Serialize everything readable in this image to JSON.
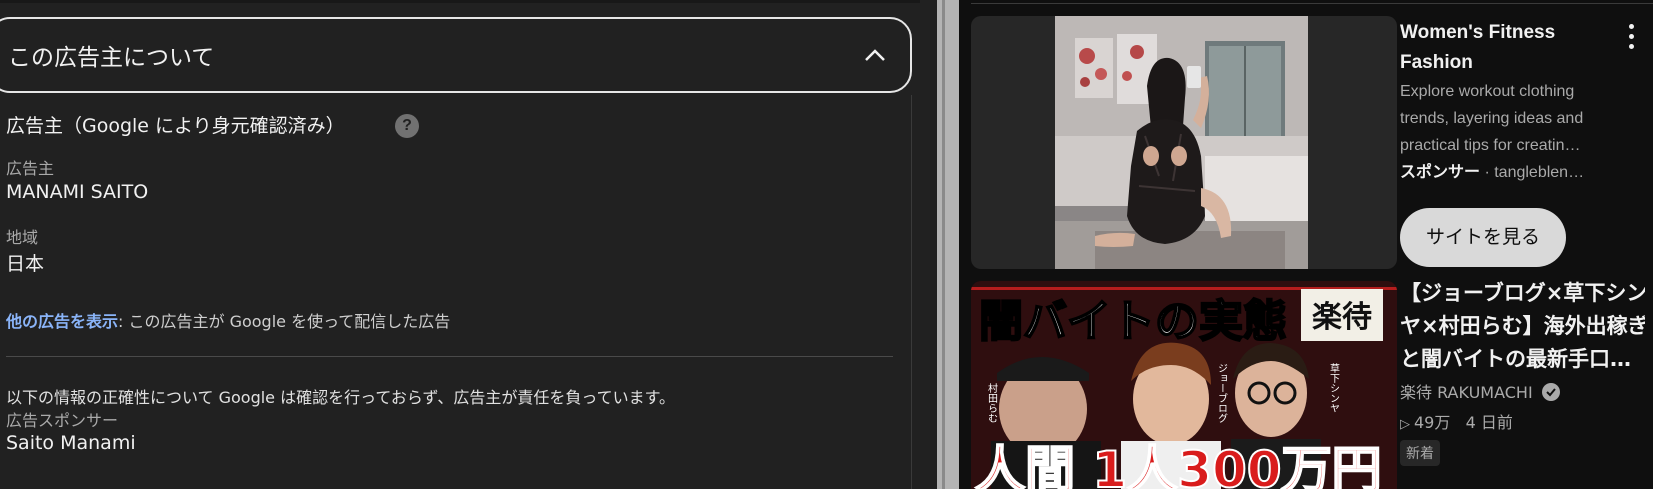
{
  "left_panel": {
    "about_title": "この広告主について",
    "section_heading": "広告主（Google により身元確認済み）",
    "help_glyph": "?",
    "advertiser_label": "広告主",
    "advertiser_value": "MANAMI SAITO",
    "region_label": "地域",
    "region_value": "日本",
    "more_ads_link": "他の広告を表示",
    "more_ads_text": ": この広告主が Google を使って配信した広告",
    "disclaimer": "以下の情報の正確性について Google は確認を行っておらず、広告主が責任を負っています。",
    "sponsor_label": "広告スポンサー",
    "sponsor_value": "Saito Manami"
  },
  "ad_card": {
    "title_line1": "Women's Fitness",
    "title_line2": "Fashion",
    "desc_line1": "Explore workout clothing",
    "desc_line2": "trends, layering ideas and",
    "desc_line3": "practical tips for creatin…",
    "sponsor_label": "スポンサー",
    "sponsor_sep": " · ",
    "sponsor_domain": "tangleblen…",
    "visit_button": "サイトを見る"
  },
  "video_card": {
    "thumbnail": {
      "main_text": "闇バイトの実態",
      "tag": "楽待",
      "name_left": "村田らむ",
      "name_mid": "ジョーブログ",
      "name_right": "草下シンヤ",
      "bottom_text": "人間 1人300万円"
    },
    "title_line1": "【ジョーブログ×草下シン",
    "title_line2": "ヤ×村田らむ】海外出稼ぎ",
    "title_line3": "と闇バイトの最新手口…",
    "channel": "楽待 RAKUMACHI",
    "views": "49万",
    "age": "4 日前",
    "badge": "新着"
  },
  "icons": {
    "help": "question-circle-icon",
    "collapse": "chevron-up-icon",
    "menu": "kebab-menu-icon",
    "verified": "verified-check-icon",
    "views": "play-triangle-icon"
  }
}
